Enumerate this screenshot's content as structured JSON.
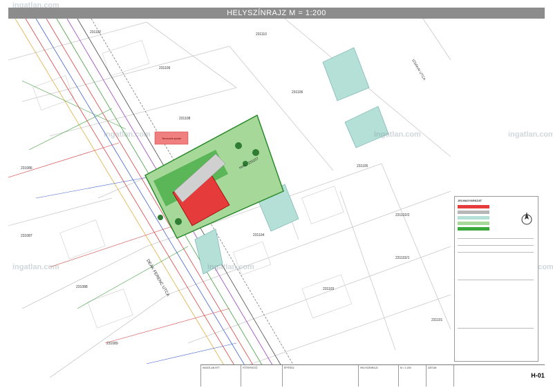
{
  "header": {
    "title": "HELYSZÍNRAJZ M = 1:200"
  },
  "watermarks": [
    "ingatlan.com",
    "ingatlan.com",
    "ingatlan.com",
    "ingatlan.com",
    "ingatlan.com",
    "ingatlan.com",
    "ingatlan.com"
  ],
  "plots": {
    "p231112": "231112",
    "p231110": "231110",
    "p231109": "231109",
    "p231108": "231108",
    "p231107": "231107",
    "p231106": "231106",
    "p231105": "231105",
    "p231104": "231104",
    "p231103": "231103",
    "p231102_2": "231102/2",
    "p231102_1": "231102/1",
    "p231101": "231101",
    "p231086": "231086",
    "p231087": "231087",
    "p231088": "231088",
    "p231089": "231089"
  },
  "streets": {
    "main": "DEÁK FERENC UTCA",
    "side": "IZSÁKAI UTCA"
  },
  "plot_label": "Hrsz.: 231107",
  "notes": {
    "red_box": "Tervezett épület"
  },
  "legend": {
    "title": "JELMAGYARÁZAT",
    "swatch_colors": [
      "#e63b3b",
      "#b7b7b7",
      "#b5e0d8",
      "#a6d89a",
      "#3aa83a"
    ]
  },
  "title_block": {
    "c1": "INGATLAN KFT.",
    "c2": "FŐTERVEZŐ",
    "c3": "ÉPÍTÉSZ",
    "c4": "HELYSZÍNRAJZ",
    "c5": "M = 1:200",
    "c6": "DÁTUM"
  },
  "sheet": {
    "code": "H-01"
  }
}
